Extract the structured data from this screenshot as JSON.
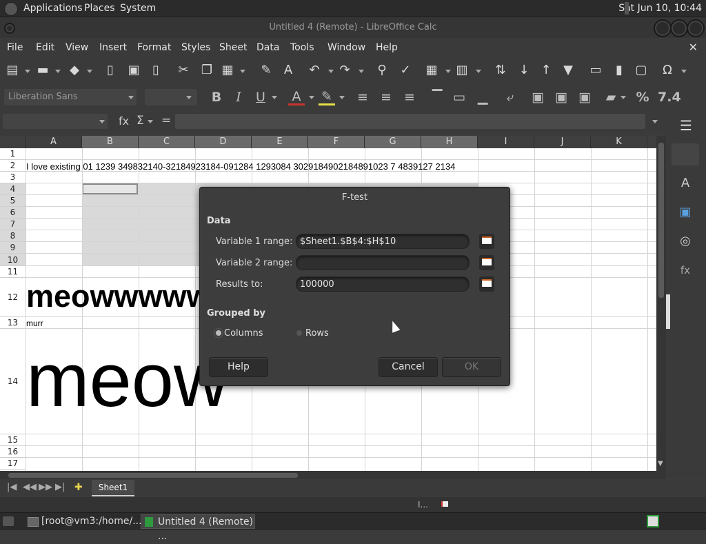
{
  "top_panel": {
    "menus": [
      "Applications",
      "Places",
      "System"
    ],
    "clock": "Sat Jun 10, 10:44"
  },
  "window": {
    "title": "Untitled 4 (Remote) - LibreOffice Calc"
  },
  "menubar": [
    "File",
    "Edit",
    "View",
    "Insert",
    "Format",
    "Styles",
    "Sheet",
    "Data",
    "Tools",
    "Window",
    "Help"
  ],
  "formatting": {
    "font_name": "Liberation Sans",
    "font_size": "",
    "bold": "B",
    "italic": "I",
    "underline": "U",
    "percent": "%",
    "number_format": "7.4"
  },
  "formula_bar": {
    "function_icon": "fx",
    "sum_icon": "Σ",
    "equals": "="
  },
  "sheet": {
    "columns": [
      "A",
      "B",
      "C",
      "D",
      "E",
      "F",
      "G",
      "H",
      "I",
      "J",
      "K"
    ],
    "rows": [
      "1",
      "2",
      "3",
      "4",
      "5",
      "6",
      "7",
      "8",
      "9",
      "10",
      "11",
      "12",
      "13",
      "14",
      "15",
      "16",
      "17"
    ],
    "cells": {
      "A2": "I love existing 01 1239 349832140-32184923184-091284 1293084 3029184902184891023 7 4839127 2134",
      "A12": "meowwwww",
      "A13": "murr",
      "A14": "meow"
    },
    "tab": "Sheet1"
  },
  "dialog": {
    "title": "F-test",
    "section_data": "Data",
    "var1_label": "Variable 1 range:",
    "var1_value": "$Sheet1.$B$4:$H$10",
    "var2_label": "Variable 2 range:",
    "var2_value": "",
    "results_label": "Results to:",
    "results_value": "100000",
    "grouped_by": "Grouped by",
    "opt_columns": "Columns",
    "opt_rows": "Rows",
    "help": "Help",
    "cancel": "Cancel",
    "ok": "OK"
  },
  "statusbar": {
    "indicator": "I..."
  },
  "taskbar": {
    "items": [
      "[root@vm3:/home/...",
      "Untitled 4 (Remote) ..."
    ]
  }
}
